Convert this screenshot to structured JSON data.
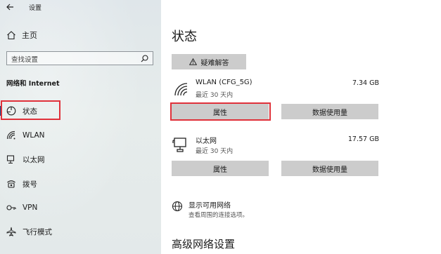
{
  "app": {
    "title": "设置"
  },
  "sidebar": {
    "home_label": "主页",
    "search_placeholder": "查找设置",
    "section_title": "网络和 Internet",
    "items": [
      {
        "label": "状态",
        "icon": "status-icon",
        "selected": true
      },
      {
        "label": "WLAN",
        "icon": "wifi-icon",
        "selected": false
      },
      {
        "label": "以太网",
        "icon": "ethernet-icon",
        "selected": false
      },
      {
        "label": "拨号",
        "icon": "dialup-icon",
        "selected": false
      },
      {
        "label": "VPN",
        "icon": "vpn-icon",
        "selected": false
      },
      {
        "label": "飞行模式",
        "icon": "airplane-icon",
        "selected": false
      }
    ]
  },
  "main": {
    "title": "状态",
    "troubleshoot_label": "疑难解答",
    "networks": [
      {
        "name": "WLAN (CFG_5G)",
        "period": "最近 30 天内",
        "usage": "7.34 GB",
        "icon": "wifi-icon",
        "properties_label": "属性",
        "data_usage_label": "数据使用量"
      },
      {
        "name": "以太网",
        "period": "最近 30 天内",
        "usage": "17.57 GB",
        "icon": "ethernet-icon",
        "properties_label": "属性",
        "data_usage_label": "数据使用量"
      }
    ],
    "show_networks": {
      "title": "显示可用网络",
      "subtitle": "查看周围的连接选项。"
    },
    "advanced_title": "高级网络设置"
  },
  "colors": {
    "highlight": "#e0313a",
    "accent": "#0a4f8a",
    "button": "#cccccc"
  }
}
